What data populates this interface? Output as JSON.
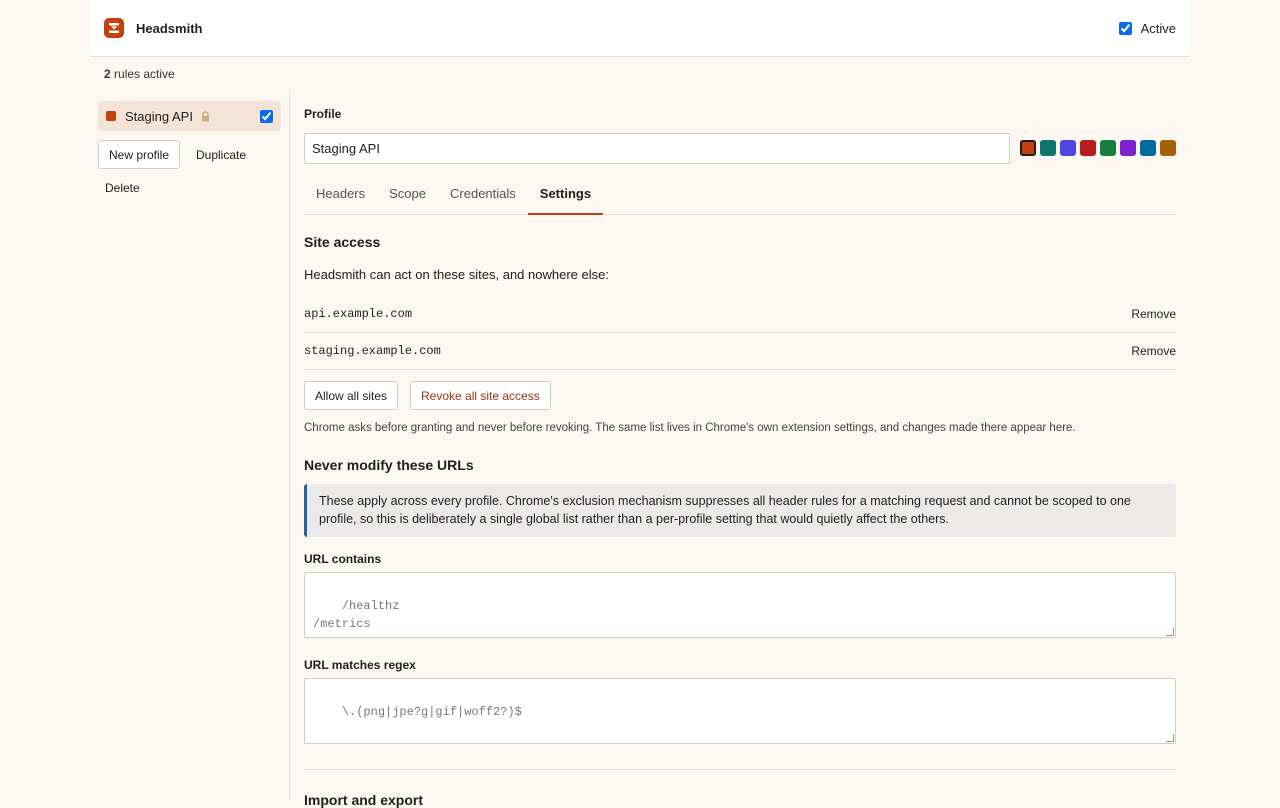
{
  "header": {
    "app_name": "Headsmith",
    "active_label": "Active",
    "active_checked": true
  },
  "rules": {
    "count": "2",
    "suffix": "rules active"
  },
  "sidebar": {
    "profile": {
      "name": "Staging API",
      "color": "#c2410c",
      "locked": true,
      "enabled": true
    },
    "new_profile_label": "New profile",
    "duplicate_label": "Duplicate",
    "delete_label": "Delete"
  },
  "main": {
    "profile_label": "Profile",
    "profile_name_value": "Staging API",
    "colors": [
      "#c2410c",
      "#0f766e",
      "#4f46e5",
      "#b91c1c",
      "#15803d",
      "#7e22ce",
      "#0369a1",
      "#a16207"
    ],
    "selected_color": 0,
    "tabs": [
      {
        "label": "Headers",
        "active": false
      },
      {
        "label": "Scope",
        "active": false
      },
      {
        "label": "Credentials",
        "active": false
      },
      {
        "label": "Settings",
        "active": true
      }
    ]
  },
  "settings": {
    "site_access_title": "Site access",
    "site_access_desc": "Headsmith can act on these sites, and nowhere else:",
    "sites": [
      {
        "host": "api.example.com",
        "remove_label": "Remove"
      },
      {
        "host": "staging.example.com",
        "remove_label": "Remove"
      }
    ],
    "allow_all_label": "Allow all sites",
    "revoke_all_label": "Revoke all site access",
    "chrome_note": "Chrome asks before granting and never before revoking. The same list lives in Chrome's own extension settings, and changes made there appear here.",
    "never_modify_title": "Never modify these URLs",
    "callout": "These apply across every profile. Chrome's exclusion mechanism suppresses all header rules for a matching request and cannot be scoped to one profile, so this is deliberately a single global list rather than a per-profile setting that would quietly affect the others.",
    "url_contains_label": "URL contains",
    "url_contains_value": "/healthz\n/metrics",
    "url_regex_label": "URL matches regex",
    "url_regex_value": "\\.(png|jpe?g|gif|woff2?)$",
    "import_export_title": "Import and export"
  },
  "icons": {
    "logo": "headsmith-logo-icon",
    "lock": "lock-icon"
  }
}
